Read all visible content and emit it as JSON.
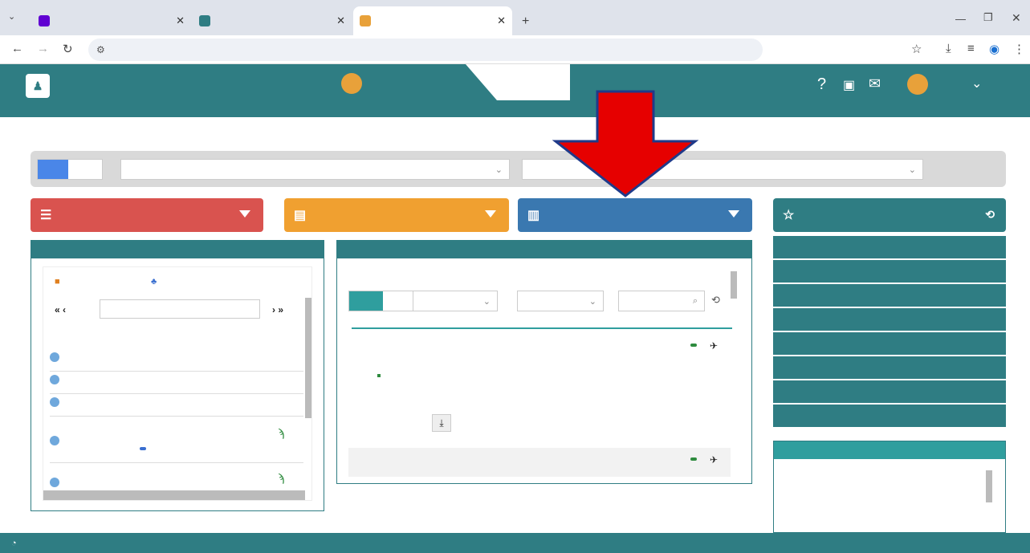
{
  "browser": {
    "tabs": [
      {
        "label": ""
      },
      {
        "label": ""
      },
      {
        "label": ""
      }
    ],
    "new_tab": "",
    "url": ""
  },
  "header": {
    "logo_line1": "",
    "logo_line2": "",
    "anno_label1": "",
    "anno_label2": "",
    "anno_value": "",
    "grado": "",
    "brand": "",
    "user": "",
    "sd": ""
  },
  "date_line": "",
  "events_line": "",
  "filters": {
    "le_mie": "",
    "class_select": "",
    "subject_select": ""
  },
  "sections": {
    "registro_classe": "",
    "registro_docente": "",
    "programmazione": "",
    "menu_veloce": ""
  },
  "oggi": {
    "title": "",
    "tab_firme": "",
    "tab_colloqui": "",
    "date": "",
    "col_ora": "",
    "col_lezioni": "",
    "rows": [
      {
        "n": "",
        "text": "",
        "tag": ""
      },
      {
        "n": "",
        "text": "",
        "tag": ""
      },
      {
        "n": "",
        "text": "",
        "tag": ""
      },
      {
        "n": "",
        "text": "",
        "tag": ""
      },
      {
        "n": "",
        "text": "",
        "tag": ""
      }
    ]
  },
  "comunicazioni": {
    "title": "",
    "att": "",
    "tipo": "",
    "autori": "",
    "search_placeholder": "",
    "items": [
      {
        "day": "",
        "month": "",
        "year": "",
        "tag": "",
        "title": "",
        "author": "",
        "status": "",
        "count": "",
        "status_color": "#d00"
      },
      {
        "day": "",
        "month": "",
        "year": "",
        "tag": "",
        "title": "",
        "author": "",
        "status": "",
        "count": "",
        "status_color": "#1a8a2a"
      }
    ]
  },
  "menu": [
    {
      "label": ""
    },
    {
      "label": ""
    },
    {
      "label": ""
    },
    {
      "label": ""
    },
    {
      "label": ""
    },
    {
      "label": ""
    },
    {
      "label": ""
    },
    {
      "label": ""
    }
  ],
  "statistiche": {
    "title": "",
    "section": "",
    "sep": "",
    "line1_label": "",
    "line1_value": "",
    "line2_label": "",
    "line2_value": "",
    "line3_label": "",
    "line3_value": ""
  },
  "footer": {
    "text": "",
    "assistenza": ""
  }
}
